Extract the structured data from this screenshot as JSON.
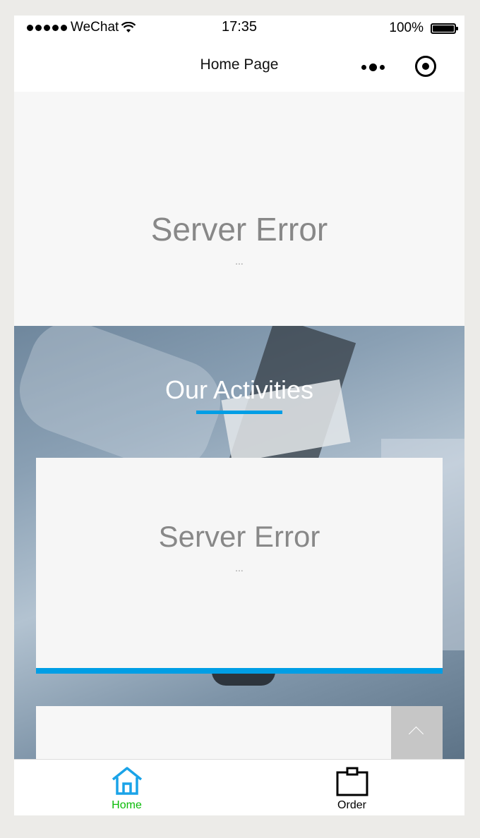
{
  "status_bar": {
    "carrier": "WeChat",
    "time": "17:35",
    "battery": "100%"
  },
  "nav": {
    "title": "Home Page"
  },
  "hero": {
    "error_title": "Server Error",
    "error_sub": "..."
  },
  "activities": {
    "title": "Our Activities",
    "card": {
      "error_title": "Server Error",
      "error_sub": "..."
    }
  },
  "tabbar": {
    "items": [
      {
        "label": "Home",
        "icon": "home-icon",
        "active": true
      },
      {
        "label": "Order",
        "icon": "clipboard-icon",
        "active": false
      }
    ]
  },
  "colors": {
    "accent_blue": "#009ee5",
    "active_tab_text": "#09bb07",
    "error_text": "#888888"
  }
}
